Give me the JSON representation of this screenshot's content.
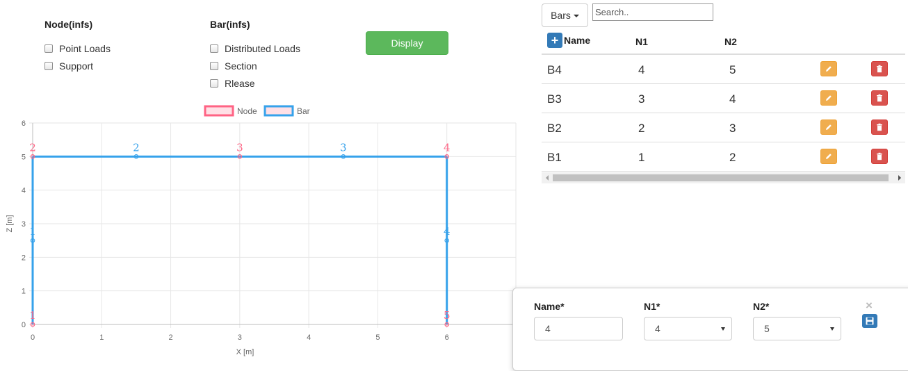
{
  "node_panel": {
    "heading": "Node(infs)",
    "options": [
      {
        "label": "Point Loads",
        "checked": false
      },
      {
        "label": "Support",
        "checked": false
      }
    ]
  },
  "bar_panel": {
    "heading": "Bar(infs)",
    "options": [
      {
        "label": "Distributed Loads",
        "checked": false
      },
      {
        "label": "Section",
        "checked": false
      },
      {
        "label": "Rlease",
        "checked": false
      }
    ]
  },
  "display_button": "Display",
  "chart_data": {
    "type": "scatter",
    "xlabel": "X [m]",
    "ylabel": "Z [m]",
    "xlim": [
      0,
      7
    ],
    "ylim": [
      0,
      6
    ],
    "xticks": [
      "0",
      "1",
      "2",
      "3",
      "4",
      "5",
      "6"
    ],
    "yticks": [
      "0",
      "1",
      "2",
      "3",
      "4",
      "5",
      "6"
    ],
    "grid": true,
    "legend_position": "top",
    "legend": [
      {
        "name": "Node",
        "color": "#ff6384"
      },
      {
        "name": "Bar",
        "color": "#36a2eb"
      }
    ],
    "nodes": [
      {
        "label": "1",
        "x": 0,
        "y": 0
      },
      {
        "label": "2",
        "x": 0,
        "y": 5
      },
      {
        "label": "3",
        "x": 3,
        "y": 5
      },
      {
        "label": "4",
        "x": 6,
        "y": 5
      },
      {
        "label": "5",
        "x": 6,
        "y": 0
      }
    ],
    "bar_midpoints": [
      {
        "label": "1",
        "x": 0,
        "y": 2.5
      },
      {
        "label": "2",
        "x": 1.5,
        "y": 5
      },
      {
        "label": "3",
        "x": 4.5,
        "y": 5
      },
      {
        "label": "4",
        "x": 6,
        "y": 2.5
      }
    ],
    "bars": [
      {
        "from": [
          0,
          0
        ],
        "to": [
          0,
          5
        ]
      },
      {
        "from": [
          0,
          5
        ],
        "to": [
          3,
          5
        ]
      },
      {
        "from": [
          3,
          5
        ],
        "to": [
          6,
          5
        ]
      },
      {
        "from": [
          6,
          5
        ],
        "to": [
          6,
          0
        ]
      }
    ]
  },
  "table": {
    "dropdown_label": "Bars",
    "search_placeholder": "Search..",
    "add_icon": "plus-icon",
    "headers": {
      "name": "Name",
      "n1": "N1",
      "n2": "N2"
    },
    "rows": [
      {
        "name": "B4",
        "n1": "4",
        "n2": "5"
      },
      {
        "name": "B3",
        "n1": "3",
        "n2": "4"
      },
      {
        "name": "B2",
        "n1": "2",
        "n2": "3"
      },
      {
        "name": "B1",
        "n1": "1",
        "n2": "2"
      }
    ],
    "edit_icon": "pencil-icon",
    "delete_icon": "trash-icon"
  },
  "edit_form": {
    "name_label": "Name*",
    "name_value": "4",
    "n1_label": "N1*",
    "n1_value": "4",
    "n2_label": "N2*",
    "n2_value": "5",
    "close_icon": "close-icon",
    "save_icon": "floppy-disk-icon"
  },
  "colors": {
    "display_button": "#5cb85c",
    "primary": "#337ab7",
    "edit": "#f0ad4e",
    "delete": "#d9534f"
  }
}
